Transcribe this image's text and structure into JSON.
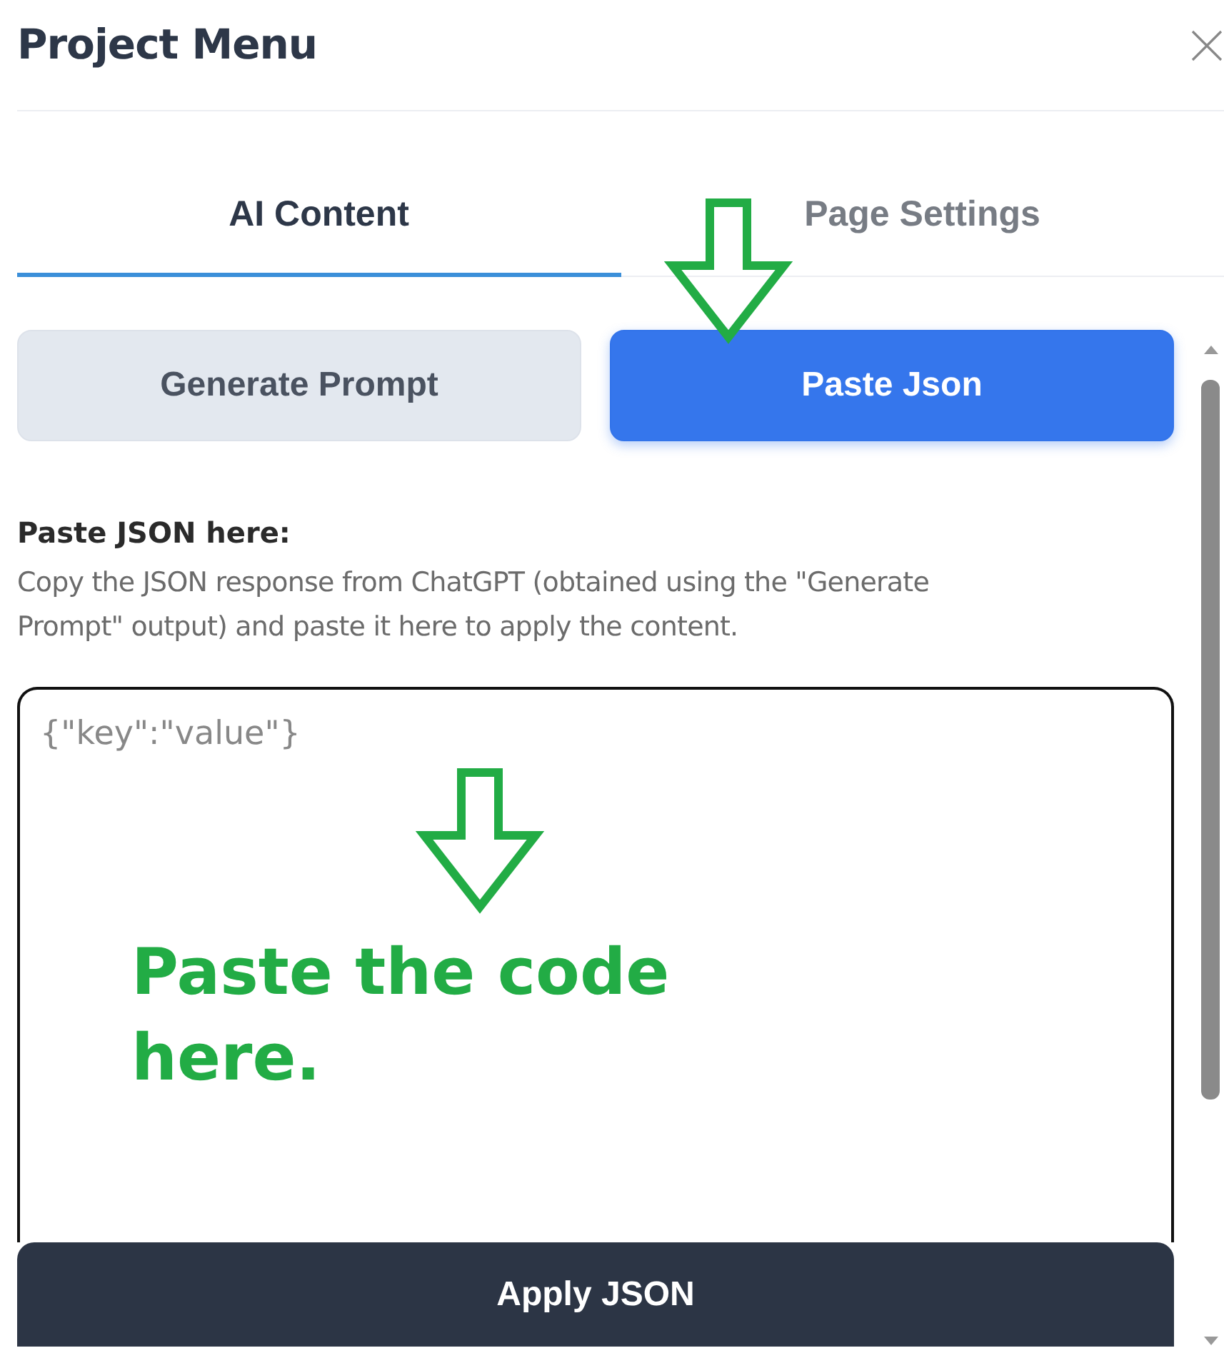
{
  "title": "Project Menu",
  "tabs": [
    {
      "label": "AI Content",
      "selected": true
    },
    {
      "label": "Page Settings",
      "selected": false
    }
  ],
  "mode_buttons": [
    {
      "label": "Generate Prompt",
      "selected": false
    },
    {
      "label": "Paste Json",
      "selected": true
    }
  ],
  "paste_section": {
    "label": "Paste JSON here:",
    "description": "Copy the JSON response from ChatGPT (obtained using the \"Generate Prompt\" output) and paste it here to apply the content."
  },
  "json_field": {
    "placeholder": "{\"key\":\"value\"}"
  },
  "annotation": {
    "text": "Paste the code here."
  },
  "apply_button": {
    "label": "Apply JSON"
  }
}
